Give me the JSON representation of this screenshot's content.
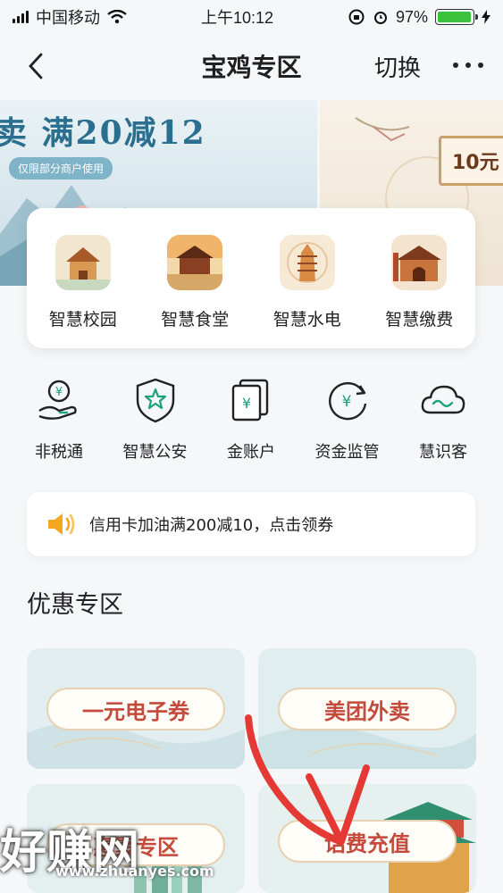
{
  "status": {
    "carrier": "中国移动",
    "time": "上午10:12",
    "battery": "97%",
    "battery_level": 0.97
  },
  "nav": {
    "title": "宝鸡专区",
    "switch_label": "切换"
  },
  "banner": {
    "title": "卖 满20减12",
    "tag": "仅限部分商户使用",
    "side_label": "10元"
  },
  "quick_services": [
    {
      "label": "智慧校园",
      "icon": "campus-tower-icon"
    },
    {
      "label": "智慧食堂",
      "icon": "canteen-building-icon"
    },
    {
      "label": "智慧水电",
      "icon": "pagoda-icon"
    },
    {
      "label": "智慧缴费",
      "icon": "city-gate-icon"
    }
  ],
  "tools": [
    {
      "label": "非税通",
      "icon": "yen-hand-icon"
    },
    {
      "label": "智慧公安",
      "icon": "police-shield-icon"
    },
    {
      "label": "金账户",
      "icon": "gold-account-icon"
    },
    {
      "label": "资金监管",
      "icon": "fund-supervision-icon"
    },
    {
      "label": "慧识客",
      "icon": "cloud-wave-icon"
    }
  ],
  "notice": {
    "text": "信用卡加油满200减10，点击领券"
  },
  "promo_section": {
    "title": "优惠专区",
    "cards": [
      {
        "label": "一元电子券"
      },
      {
        "label": "美团外卖"
      },
      {
        "label": "惠聚专区"
      },
      {
        "label": "话费充值"
      }
    ]
  },
  "watermark": {
    "text": "好赚网",
    "url": "www.zhuanyes.com"
  },
  "colors": {
    "accent": "#1aa37a",
    "promo_text": "#c44a3c",
    "annotation": "#e53935"
  }
}
